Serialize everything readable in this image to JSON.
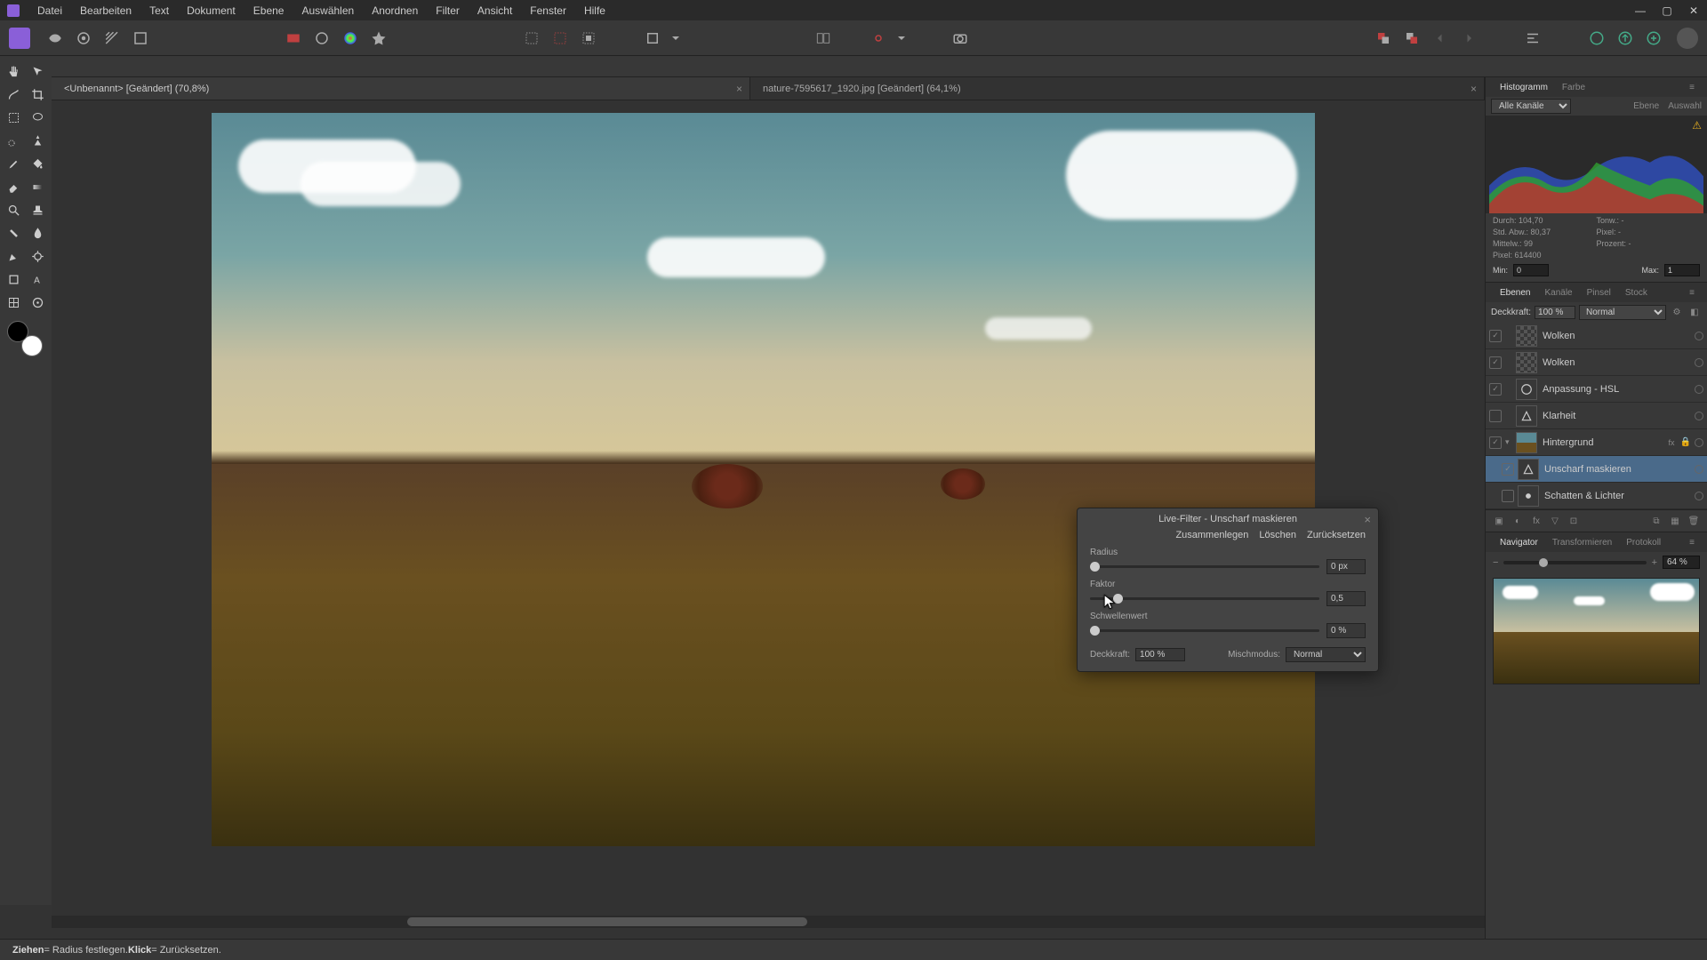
{
  "menu": [
    "Datei",
    "Bearbeiten",
    "Text",
    "Dokument",
    "Ebene",
    "Auswählen",
    "Anordnen",
    "Filter",
    "Ansicht",
    "Fenster",
    "Hilfe"
  ],
  "tabs": [
    {
      "label": "<Unbenannt> [Geändert] (70,8%)",
      "active": true
    },
    {
      "label": "nature-7595617_1920.jpg [Geändert] (64,1%)",
      "active": false
    }
  ],
  "right": {
    "histogram_tabs": [
      "Histogramm",
      "Farbe"
    ],
    "histogram_channel": "Alle Kanäle",
    "btn_ebene": "Ebene",
    "btn_auswahl": "Auswahl",
    "stats": {
      "durch_label": "Durch:",
      "durch": "104,70",
      "std_label": "Std. Abw.:",
      "std": "80,37",
      "mittelw_label": "Mittelw.:",
      "mittelw": "99",
      "pixel_label": "Pixel:",
      "pixel": "614400",
      "tonw_label": "Tonw.:",
      "tonw": "-",
      "pixel2_label": "Pixel:",
      "pixel2": "-",
      "prozent_label": "Prozent:",
      "prozent": "-"
    },
    "min_label": "Min:",
    "min": "0",
    "max_label": "Max:",
    "max": "1",
    "layer_tabs": [
      "Ebenen",
      "Kanäle",
      "Pinsel",
      "Stock"
    ],
    "opacity_label": "Deckkraft:",
    "opacity": "100 %",
    "blend": "Normal",
    "layers": [
      {
        "name": "Wolken",
        "type": "pixel",
        "vis": true
      },
      {
        "name": "Wolken",
        "type": "pixel",
        "vis": true
      },
      {
        "name": "Anpassung - HSL",
        "type": "adj",
        "vis": true,
        "icon": "hsl"
      },
      {
        "name": "Klarheit",
        "type": "adj",
        "vis": false,
        "icon": "tri"
      },
      {
        "name": "Hintergrund",
        "type": "image",
        "vis": true,
        "fx": "fx",
        "locked": true,
        "expanded": true
      },
      {
        "name": "Unscharf maskieren",
        "type": "adj",
        "vis": true,
        "icon": "tri",
        "child": true,
        "selected": true
      },
      {
        "name": "Schatten & Lichter",
        "type": "adj",
        "vis": false,
        "icon": "sun",
        "child": true
      }
    ],
    "nav_tabs": [
      "Navigator",
      "Transformieren",
      "Protokoll"
    ],
    "zoom": "64 %"
  },
  "dialog": {
    "title": "Live-Filter - Unscharf maskieren",
    "actions": [
      "Zusammenlegen",
      "Löschen",
      "Zurücksetzen"
    ],
    "sliders": [
      {
        "label": "Radius",
        "value": "0 px",
        "pos": 0
      },
      {
        "label": "Faktor",
        "value": "0,5",
        "pos": 10
      },
      {
        "label": "Schwellenwert",
        "value": "0 %",
        "pos": 0
      }
    ],
    "opacity_label": "Deckkraft:",
    "opacity": "100 %",
    "blend_label": "Mischmodus:",
    "blend": "Normal"
  },
  "status": {
    "t1": "Ziehen",
    "t2": " = Radius festlegen. ",
    "t3": "Klick",
    "t4": " = Zurücksetzen."
  }
}
